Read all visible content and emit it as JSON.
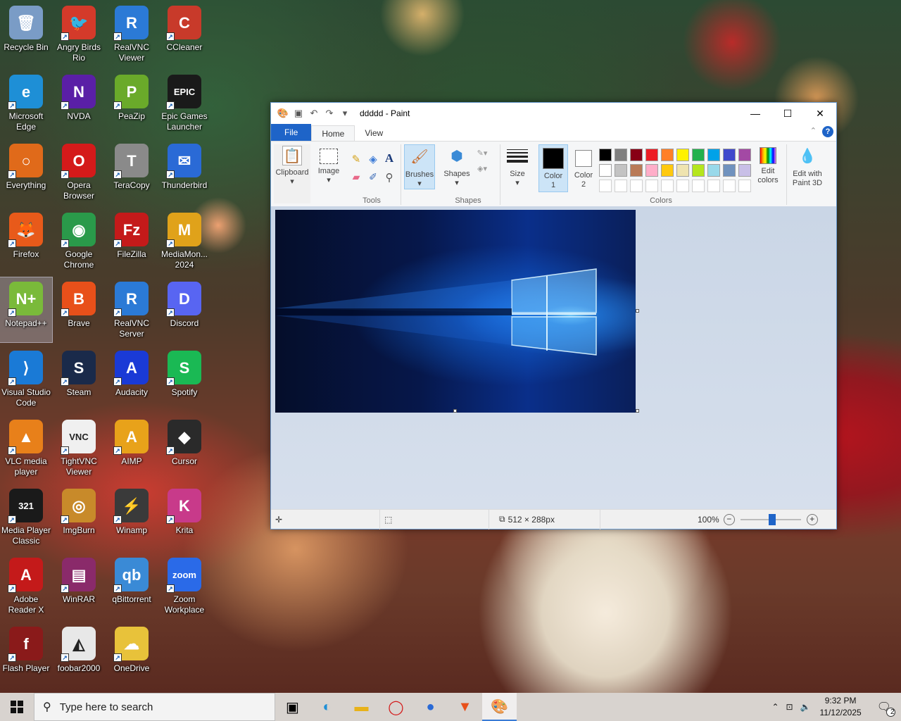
{
  "desktop": {
    "icons": [
      {
        "label": "Recycle Bin",
        "glyph": "🗑",
        "color": "#7a9cc6"
      },
      {
        "label": "Angry Birds Rio",
        "glyph": "🐦",
        "color": "#d43a2a"
      },
      {
        "label": "RealVNC Viewer",
        "glyph": "R",
        "color": "#2b7ad6"
      },
      {
        "label": "CCleaner",
        "glyph": "C",
        "color": "#c83a2a"
      },
      {
        "label": "Microsoft Edge",
        "glyph": "e",
        "color": "#1e8fd6"
      },
      {
        "label": "NVDA",
        "glyph": "N",
        "color": "#5a1fa6"
      },
      {
        "label": "PeaZip",
        "glyph": "P",
        "color": "#6aaa2a"
      },
      {
        "label": "Epic Games Launcher",
        "glyph": "EPIC",
        "color": "#1a1a1a"
      },
      {
        "label": "Everything",
        "glyph": "○",
        "color": "#e06a1a"
      },
      {
        "label": "Opera Browser",
        "glyph": "O",
        "color": "#d41a1a"
      },
      {
        "label": "TeraCopy",
        "glyph": "T",
        "color": "#8a8a8a"
      },
      {
        "label": "Thunderbird",
        "glyph": "✉",
        "color": "#2a6ad6"
      },
      {
        "label": "Firefox",
        "glyph": "🦊",
        "color": "#e85a1a"
      },
      {
        "label": "Google Chrome",
        "glyph": "◉",
        "color": "#2a9a4a"
      },
      {
        "label": "FileZilla",
        "glyph": "Fz",
        "color": "#c41a1a"
      },
      {
        "label": "MediaMon... 2024",
        "glyph": "M",
        "color": "#e0a21a"
      },
      {
        "label": "Notepad++",
        "glyph": "N+",
        "color": "#7aba3a"
      },
      {
        "label": "Brave",
        "glyph": "B",
        "color": "#e8501a"
      },
      {
        "label": "RealVNC Server",
        "glyph": "R",
        "color": "#2b7ad6"
      },
      {
        "label": "Discord",
        "glyph": "D",
        "color": "#5865f2"
      },
      {
        "label": "Visual Studio Code",
        "glyph": "⟩",
        "color": "#1a7ad6"
      },
      {
        "label": "Steam",
        "glyph": "S",
        "color": "#1a2a4a"
      },
      {
        "label": "Audacity",
        "glyph": "A",
        "color": "#1a3ad6"
      },
      {
        "label": "Spotify",
        "glyph": "S",
        "color": "#1ab954"
      },
      {
        "label": "VLC media player",
        "glyph": "▲",
        "color": "#e8801a"
      },
      {
        "label": "TightVNC Viewer",
        "glyph": "VNC",
        "color": "#f0f0f0"
      },
      {
        "label": "AIMP",
        "glyph": "A",
        "color": "#e8a21a"
      },
      {
        "label": "Cursor",
        "glyph": "◆",
        "color": "#2a2a2a"
      },
      {
        "label": "Media Player Classic",
        "glyph": "321",
        "color": "#1a1a1a"
      },
      {
        "label": "ImgBurn",
        "glyph": "◎",
        "color": "#c88a2a"
      },
      {
        "label": "Winamp",
        "glyph": "⚡",
        "color": "#3a3a3a"
      },
      {
        "label": "Krita",
        "glyph": "K",
        "color": "#c83a8a"
      },
      {
        "label": "Adobe Reader X",
        "glyph": "A",
        "color": "#c41a1a"
      },
      {
        "label": "WinRAR",
        "glyph": "▤",
        "color": "#8a2a6a"
      },
      {
        "label": "qBittorrent",
        "glyph": "qb",
        "color": "#3a8ad6"
      },
      {
        "label": "Zoom Workplace",
        "glyph": "zoom",
        "color": "#2a6ae8"
      },
      {
        "label": "Flash Player",
        "glyph": "f",
        "color": "#8a1a1a"
      },
      {
        "label": "foobar2000",
        "glyph": "◭",
        "color": "#e8e8e8"
      },
      {
        "label": "OneDrive",
        "glyph": "☁",
        "color": "#e8c23a"
      }
    ]
  },
  "paint": {
    "title": "ddddd - Paint",
    "tabs": {
      "file": "File",
      "home": "Home",
      "view": "View"
    },
    "ribbon": {
      "clipboard": "Clipboard",
      "image": "Image",
      "tools_group": "Tools",
      "brushes": "Brushes",
      "shapes": "Shapes",
      "shapes_group": "Shapes",
      "size": "Size",
      "color1": "Color 1",
      "color2": "Color 2",
      "colors_group": "Colors",
      "edit_colors": "Edit colors",
      "edit_with_paint3d": "Edit with Paint 3D"
    },
    "palette_row1": [
      "#000000",
      "#7f7f7f",
      "#880015",
      "#ed1c24",
      "#ff7f27",
      "#fff200",
      "#22b14c",
      "#00a2e8",
      "#3f48cc",
      "#a349a4"
    ],
    "palette_row2": [
      "#ffffff",
      "#c3c3c3",
      "#b97a57",
      "#ffaec9",
      "#ffc90e",
      "#efe4b0",
      "#b5e61d",
      "#99d9ea",
      "#7092be",
      "#c8bfe7"
    ],
    "status": {
      "dimensions": "512 × 288px",
      "zoom": "100%"
    }
  },
  "taskbar": {
    "search_placeholder": "Type here to search",
    "time": "9:32 PM",
    "date": "11/12/2025",
    "notification_count": "2"
  }
}
